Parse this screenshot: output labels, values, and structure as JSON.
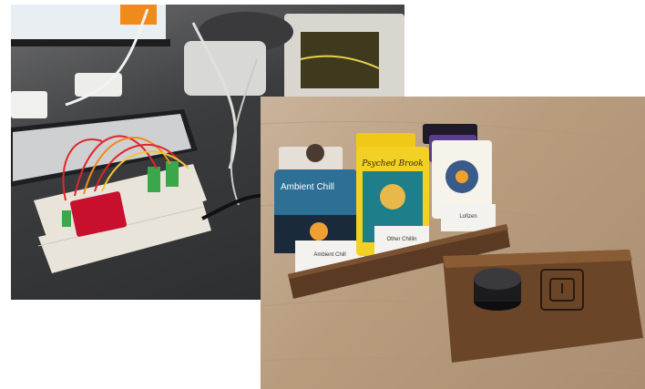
{
  "photos": [
    {
      "name": "breadboard-prototype-photo"
    },
    {
      "name": "music-card-player-photo"
    }
  ],
  "cards": [
    {
      "title": "Ambient Chill",
      "label": "Ambient Chill"
    },
    {
      "title": "Psyched Brook",
      "label": "Other Chillin"
    },
    {
      "title": "",
      "label": "Lofizen"
    }
  ],
  "colors": {
    "wood_dark": "#5a3a22",
    "wood_light": "#c9b39a",
    "breadboard": "#e9e4da",
    "sensor_board": "#c8102e",
    "knob": "#1c1c1e"
  }
}
